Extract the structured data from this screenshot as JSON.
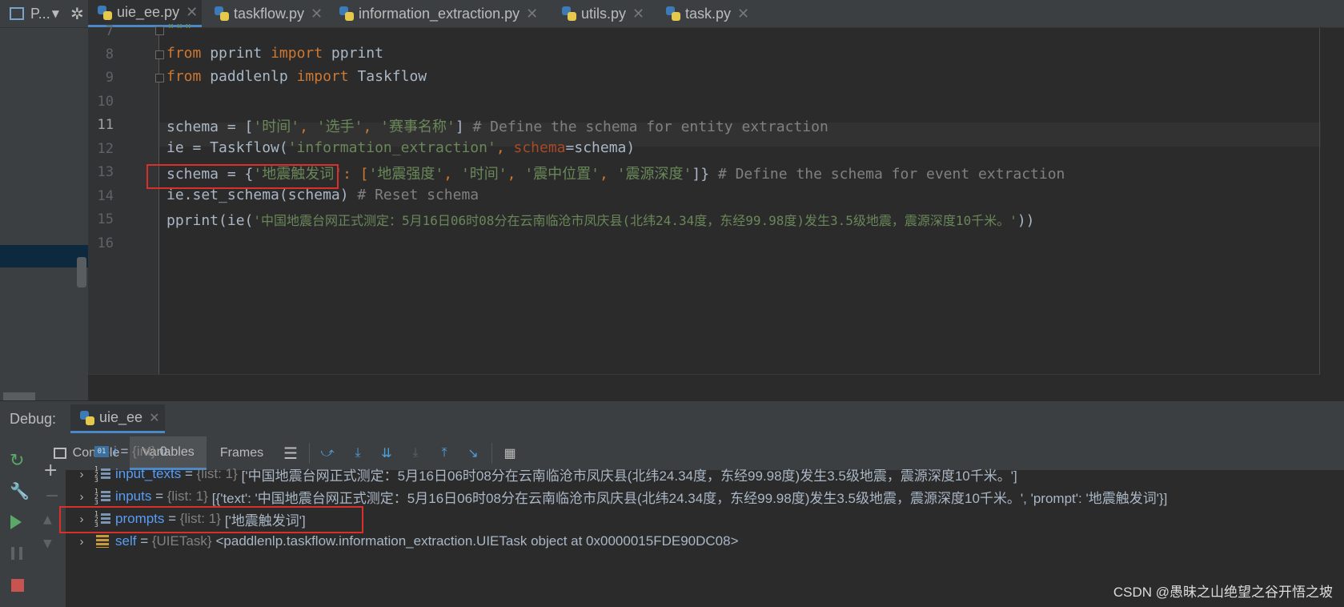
{
  "project_label": "P...",
  "tabs": [
    {
      "label": "uie_ee.py",
      "active": true
    },
    {
      "label": "taskflow.py",
      "active": false
    },
    {
      "label": "information_extraction.py",
      "active": false
    },
    {
      "label": "utils.py",
      "active": false
    },
    {
      "label": "task.py",
      "active": false
    }
  ],
  "editor": {
    "line_numbers": [
      "7",
      "8",
      "9",
      "10",
      "11",
      "12",
      "13",
      "14",
      "15",
      "16"
    ],
    "current_line": "11",
    "lines": {
      "l7": "\"\"\"",
      "l8": {
        "kw1": "from",
        "mod": " pprint ",
        "kw2": "import",
        "name": " pprint"
      },
      "l9": {
        "kw1": "from",
        "mod": " paddlenlp ",
        "kw2": "import",
        "name": " Taskflow"
      },
      "l11": {
        "pre": "schema = [",
        "s1": "'时间'",
        "c1": ", ",
        "s2": "'选手'",
        "c2": ", ",
        "s3": "'赛事名称'",
        "post": "] ",
        "comment": "# Define the schema for entity extraction"
      },
      "l12": {
        "pre": "ie = Taskflow(",
        "s1": "'information_extraction'",
        "c1": ", ",
        "param": "schema",
        "post": "=schema)"
      },
      "l13": {
        "pre": "schema = {",
        "s1": "'地震触发词'",
        "c1": ": [",
        "s2": "'地震强度'",
        "c2": ", ",
        "s3": "'时间'",
        "c3": ", ",
        "s4": "'震中位置'",
        "c4": ", ",
        "s5": "'震源深度'",
        "post": "]} ",
        "comment": "# Define the schema for event extraction"
      },
      "l14": {
        "pre": "ie.set_schema(schema) ",
        "comment": "# Reset schema"
      },
      "l15": {
        "pre": "pprint(ie(",
        "s1": "'中国地震台网正式测定：5月16日06时08分在云南临沧市凤庆县(北纬24.34度，东经99.98度)发生3.5级地震，震源深度10千米。'",
        "post": "))"
      }
    }
  },
  "debug": {
    "header_label": "Debug:",
    "session_label": "uie_ee",
    "toolbar": {
      "console": "Console",
      "variables": "Variables",
      "frames": "Frames"
    },
    "variables": [
      {
        "name": "i",
        "type": "{int}",
        "value": "0",
        "expandable": false,
        "icon": "int-icon"
      },
      {
        "name": "input_texts",
        "type": "{list: 1}",
        "value": "['中国地震台网正式测定：5月16日06时08分在云南临沧市凤庆县(北纬24.34度，东经99.98度)发生3.5级地震，震源深度10千米。']",
        "expandable": true,
        "icon": "list-icon"
      },
      {
        "name": "inputs",
        "type": "{list: 1}",
        "value": "[{'text': '中国地震台网正式测定：5月16日06时08分在云南临沧市凤庆县(北纬24.34度，东经99.98度)发生3.5级地震，震源深度10千米。', 'prompt': '地震触发词'}]",
        "expandable": true,
        "icon": "list-icon"
      },
      {
        "name": "prompts",
        "type": "{list: 1}",
        "value": "['地震触发词']",
        "expandable": true,
        "icon": "list-icon"
      },
      {
        "name": "self",
        "type": "{UIETask}",
        "value": "<paddlenlp.taskflow.information_extraction.UIETask object at 0x0000015FDE90DC08>",
        "expandable": true,
        "icon": "object-icon"
      }
    ],
    "eq": " = "
  },
  "watermark": "CSDN @愚昧之山绝望之谷开悟之坡",
  "colors": {
    "keyword": "#cc7832",
    "string": "#6a8759",
    "comment": "#808080",
    "param": "#aa4926",
    "var_name": "#589df6",
    "highlight_box": "#d9302c"
  }
}
